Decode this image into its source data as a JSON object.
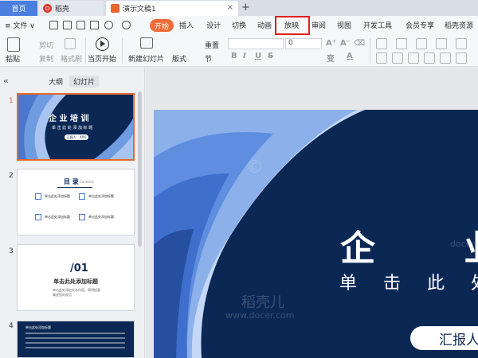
{
  "titlebar": {
    "home_tab": "首页",
    "docer_tab": "稻壳",
    "doc_tab": "演示文稿1",
    "docer_logo": "D",
    "close": "×",
    "add": "+"
  },
  "menubar": {
    "file": "≡ 文件 ∨",
    "start": "开始",
    "items": [
      "插入",
      "设计",
      "切换",
      "动画",
      "放映",
      "审阅",
      "视图",
      "开发工具",
      "会员专享",
      "稻壳资源"
    ],
    "highlighted": "放映",
    "highlight_color": "#e21d1d"
  },
  "toolbar": {
    "paste": "粘贴",
    "cut": "剪切",
    "copy": "复制",
    "format_painter": "格式刷",
    "from_current": "当页开始",
    "new_slide": "新建幻灯片",
    "layout": "版式",
    "section": "节",
    "reset": "重置",
    "font_size": "0",
    "bold": "B",
    "italic": "I",
    "underline": "U",
    "strike": "S",
    "grow": "A⁺",
    "shrink": "A⁻",
    "clear": "⌫",
    "pinyin": "变",
    "font_color": "A"
  },
  "leftpanel": {
    "collapse": "«",
    "outline_tab": "大纲",
    "slides_tab": "幻灯片",
    "slide_numbers": [
      "1",
      "2",
      "3",
      "4"
    ],
    "thumb1": {
      "title": "企 业 培 训",
      "sub": "单 击 此 处 添 加 标 题",
      "btn": "汇报人：XXX"
    },
    "thumb2": {
      "title": "目 录",
      "title_en": "Contents",
      "items": [
        "单击此处添加标题",
        "单击此处添加标题",
        "单击此处添加标题",
        "单击此处添加标题"
      ],
      "items_right": [
        "单击此处添加标题",
        "单击此处添加标题",
        "单击此处添加标题",
        "单击此处添加标题"
      ]
    },
    "thumb3": {
      "num": "/01",
      "title": "单击此处添加标题",
      "desc": "单击此处添加文本内容，简明扼要阐述您的观点"
    },
    "thumb4": {
      "title": "单击此处添加标题"
    }
  },
  "slide": {
    "title": "企 业",
    "subtitle": "单 击 此 处 添",
    "button": "汇报人",
    "watermark_cn": "稻壳儿",
    "watermark_url": "www.docer.com",
    "watermark_url2": "docer.com",
    "bg_color": "#0b2855"
  }
}
